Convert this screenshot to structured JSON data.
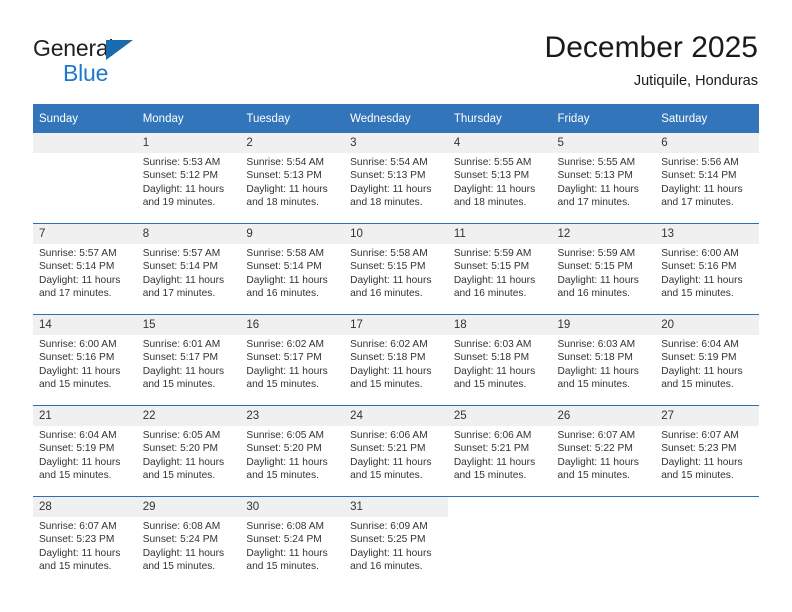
{
  "brand": {
    "name_top": "General",
    "name_bottom": "Blue",
    "accent_color": "#1b7ac9",
    "triangle_color": "#1b6ab0"
  },
  "header": {
    "title": "December 2025",
    "location": "Jutiquile, Honduras"
  },
  "theme": {
    "header_blue": "#3275bb",
    "row_divider_blue": "#2f6fb0",
    "daynum_band": "#f0f0f0",
    "text": "#333333"
  },
  "weekday_headers": [
    "Sunday",
    "Monday",
    "Tuesday",
    "Wednesday",
    "Thursday",
    "Friday",
    "Saturday"
  ],
  "weeks": [
    [
      {
        "day": "",
        "sunrise": "",
        "sunset": "",
        "daylight1": "",
        "daylight2": "",
        "blank": true
      },
      {
        "day": "1",
        "sunrise": "Sunrise: 5:53 AM",
        "sunset": "Sunset: 5:12 PM",
        "daylight1": "Daylight: 11 hours",
        "daylight2": "and 19 minutes."
      },
      {
        "day": "2",
        "sunrise": "Sunrise: 5:54 AM",
        "sunset": "Sunset: 5:13 PM",
        "daylight1": "Daylight: 11 hours",
        "daylight2": "and 18 minutes."
      },
      {
        "day": "3",
        "sunrise": "Sunrise: 5:54 AM",
        "sunset": "Sunset: 5:13 PM",
        "daylight1": "Daylight: 11 hours",
        "daylight2": "and 18 minutes."
      },
      {
        "day": "4",
        "sunrise": "Sunrise: 5:55 AM",
        "sunset": "Sunset: 5:13 PM",
        "daylight1": "Daylight: 11 hours",
        "daylight2": "and 18 minutes."
      },
      {
        "day": "5",
        "sunrise": "Sunrise: 5:55 AM",
        "sunset": "Sunset: 5:13 PM",
        "daylight1": "Daylight: 11 hours",
        "daylight2": "and 17 minutes."
      },
      {
        "day": "6",
        "sunrise": "Sunrise: 5:56 AM",
        "sunset": "Sunset: 5:14 PM",
        "daylight1": "Daylight: 11 hours",
        "daylight2": "and 17 minutes."
      }
    ],
    [
      {
        "day": "7",
        "sunrise": "Sunrise: 5:57 AM",
        "sunset": "Sunset: 5:14 PM",
        "daylight1": "Daylight: 11 hours",
        "daylight2": "and 17 minutes."
      },
      {
        "day": "8",
        "sunrise": "Sunrise: 5:57 AM",
        "sunset": "Sunset: 5:14 PM",
        "daylight1": "Daylight: 11 hours",
        "daylight2": "and 17 minutes."
      },
      {
        "day": "9",
        "sunrise": "Sunrise: 5:58 AM",
        "sunset": "Sunset: 5:14 PM",
        "daylight1": "Daylight: 11 hours",
        "daylight2": "and 16 minutes."
      },
      {
        "day": "10",
        "sunrise": "Sunrise: 5:58 AM",
        "sunset": "Sunset: 5:15 PM",
        "daylight1": "Daylight: 11 hours",
        "daylight2": "and 16 minutes."
      },
      {
        "day": "11",
        "sunrise": "Sunrise: 5:59 AM",
        "sunset": "Sunset: 5:15 PM",
        "daylight1": "Daylight: 11 hours",
        "daylight2": "and 16 minutes."
      },
      {
        "day": "12",
        "sunrise": "Sunrise: 5:59 AM",
        "sunset": "Sunset: 5:15 PM",
        "daylight1": "Daylight: 11 hours",
        "daylight2": "and 16 minutes."
      },
      {
        "day": "13",
        "sunrise": "Sunrise: 6:00 AM",
        "sunset": "Sunset: 5:16 PM",
        "daylight1": "Daylight: 11 hours",
        "daylight2": "and 15 minutes."
      }
    ],
    [
      {
        "day": "14",
        "sunrise": "Sunrise: 6:00 AM",
        "sunset": "Sunset: 5:16 PM",
        "daylight1": "Daylight: 11 hours",
        "daylight2": "and 15 minutes."
      },
      {
        "day": "15",
        "sunrise": "Sunrise: 6:01 AM",
        "sunset": "Sunset: 5:17 PM",
        "daylight1": "Daylight: 11 hours",
        "daylight2": "and 15 minutes."
      },
      {
        "day": "16",
        "sunrise": "Sunrise: 6:02 AM",
        "sunset": "Sunset: 5:17 PM",
        "daylight1": "Daylight: 11 hours",
        "daylight2": "and 15 minutes."
      },
      {
        "day": "17",
        "sunrise": "Sunrise: 6:02 AM",
        "sunset": "Sunset: 5:18 PM",
        "daylight1": "Daylight: 11 hours",
        "daylight2": "and 15 minutes."
      },
      {
        "day": "18",
        "sunrise": "Sunrise: 6:03 AM",
        "sunset": "Sunset: 5:18 PM",
        "daylight1": "Daylight: 11 hours",
        "daylight2": "and 15 minutes."
      },
      {
        "day": "19",
        "sunrise": "Sunrise: 6:03 AM",
        "sunset": "Sunset: 5:18 PM",
        "daylight1": "Daylight: 11 hours",
        "daylight2": "and 15 minutes."
      },
      {
        "day": "20",
        "sunrise": "Sunrise: 6:04 AM",
        "sunset": "Sunset: 5:19 PM",
        "daylight1": "Daylight: 11 hours",
        "daylight2": "and 15 minutes."
      }
    ],
    [
      {
        "day": "21",
        "sunrise": "Sunrise: 6:04 AM",
        "sunset": "Sunset: 5:19 PM",
        "daylight1": "Daylight: 11 hours",
        "daylight2": "and 15 minutes."
      },
      {
        "day": "22",
        "sunrise": "Sunrise: 6:05 AM",
        "sunset": "Sunset: 5:20 PM",
        "daylight1": "Daylight: 11 hours",
        "daylight2": "and 15 minutes."
      },
      {
        "day": "23",
        "sunrise": "Sunrise: 6:05 AM",
        "sunset": "Sunset: 5:20 PM",
        "daylight1": "Daylight: 11 hours",
        "daylight2": "and 15 minutes."
      },
      {
        "day": "24",
        "sunrise": "Sunrise: 6:06 AM",
        "sunset": "Sunset: 5:21 PM",
        "daylight1": "Daylight: 11 hours",
        "daylight2": "and 15 minutes."
      },
      {
        "day": "25",
        "sunrise": "Sunrise: 6:06 AM",
        "sunset": "Sunset: 5:21 PM",
        "daylight1": "Daylight: 11 hours",
        "daylight2": "and 15 minutes."
      },
      {
        "day": "26",
        "sunrise": "Sunrise: 6:07 AM",
        "sunset": "Sunset: 5:22 PM",
        "daylight1": "Daylight: 11 hours",
        "daylight2": "and 15 minutes."
      },
      {
        "day": "27",
        "sunrise": "Sunrise: 6:07 AM",
        "sunset": "Sunset: 5:23 PM",
        "daylight1": "Daylight: 11 hours",
        "daylight2": "and 15 minutes."
      }
    ],
    [
      {
        "day": "28",
        "sunrise": "Sunrise: 6:07 AM",
        "sunset": "Sunset: 5:23 PM",
        "daylight1": "Daylight: 11 hours",
        "daylight2": "and 15 minutes."
      },
      {
        "day": "29",
        "sunrise": "Sunrise: 6:08 AM",
        "sunset": "Sunset: 5:24 PM",
        "daylight1": "Daylight: 11 hours",
        "daylight2": "and 15 minutes."
      },
      {
        "day": "30",
        "sunrise": "Sunrise: 6:08 AM",
        "sunset": "Sunset: 5:24 PM",
        "daylight1": "Daylight: 11 hours",
        "daylight2": "and 15 minutes."
      },
      {
        "day": "31",
        "sunrise": "Sunrise: 6:09 AM",
        "sunset": "Sunset: 5:25 PM",
        "daylight1": "Daylight: 11 hours",
        "daylight2": "and 16 minutes."
      },
      {
        "day": "",
        "sunrise": "",
        "sunset": "",
        "daylight1": "",
        "daylight2": "",
        "blank": true
      },
      {
        "day": "",
        "sunrise": "",
        "sunset": "",
        "daylight1": "",
        "daylight2": "",
        "blank": true
      },
      {
        "day": "",
        "sunrise": "",
        "sunset": "",
        "daylight1": "",
        "daylight2": "",
        "blank": true
      }
    ]
  ]
}
